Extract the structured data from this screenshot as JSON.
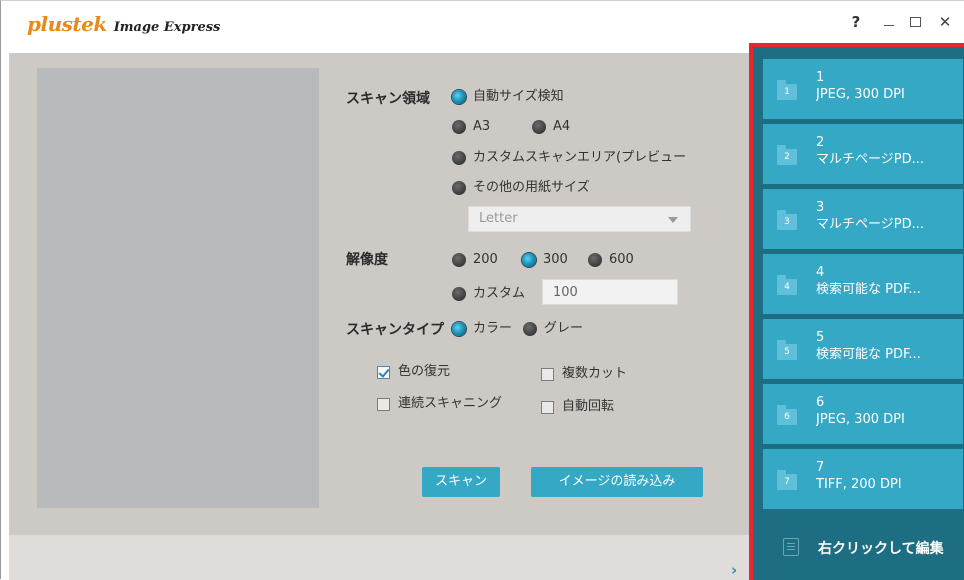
{
  "app": {
    "brand_logo": "plustek",
    "brand_name": "Image Express",
    "help_label": "?",
    "close_label": "✕"
  },
  "scan_area": {
    "label": "スキャン領域",
    "options": [
      "自動サイズ検知",
      "A3",
      "A4",
      "カスタムスキャンエリア(プレビュー",
      "その他の用紙サイズ"
    ],
    "selected": "自動サイズ検知",
    "paper_size_value": "Letter"
  },
  "resolution": {
    "label": "解像度",
    "options": [
      "200",
      "300",
      "600"
    ],
    "selected": "300",
    "custom_label": "カスタム",
    "custom_value": "100"
  },
  "scan_type": {
    "label": "スキャンタイプ",
    "options": [
      "カラー",
      "グレー"
    ],
    "selected": "カラー"
  },
  "checkboxes": [
    {
      "label": "色の復元",
      "checked": true
    },
    {
      "label": "複数カット",
      "checked": false
    },
    {
      "label": "連続スキャニング",
      "checked": false
    },
    {
      "label": "自動回転",
      "checked": false
    }
  ],
  "buttons": {
    "scan": "スキャン",
    "import": "イメージの読み込み"
  },
  "expand_arrow": "›",
  "profiles": [
    {
      "number": "1",
      "label": "JPEG, 300 DPI"
    },
    {
      "number": "2",
      "label": "マルチページPD..."
    },
    {
      "number": "3",
      "label": "マルチページPD..."
    },
    {
      "number": "4",
      "label": "検索可能な PDF..."
    },
    {
      "number": "5",
      "label": "検索可能な PDF..."
    },
    {
      "number": "6",
      "label": "JPEG, 300 DPI"
    },
    {
      "number": "7",
      "label": "TIFF, 200 DPI"
    }
  ],
  "edit_hint": "右クリックして編集",
  "colors": {
    "accent": "#35a8c6",
    "side_panel": "#1e6e83",
    "highlight_border": "#e8262f",
    "brand": "#e88a1a"
  }
}
